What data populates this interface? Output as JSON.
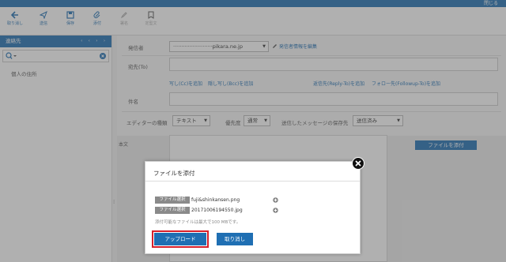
{
  "topbar": {
    "close_label": "閉じる"
  },
  "toolbar": {
    "items": [
      {
        "label": "取り消し",
        "icon": "back-arrow-icon"
      },
      {
        "label": "送信",
        "icon": "paper-plane-icon"
      },
      {
        "label": "保存",
        "icon": "floppy-disk-icon"
      },
      {
        "label": "添付",
        "icon": "paperclip-icon"
      },
      {
        "label": "署名",
        "icon": "pen-icon"
      },
      {
        "label": "定型文",
        "icon": "bookmark-icon"
      }
    ]
  },
  "sidebar": {
    "title": "連絡先",
    "nav_arrows": "‹ ‹ › ›",
    "search_placeholder": "",
    "items": [
      {
        "label": "個人の住所"
      }
    ]
  },
  "compose": {
    "from_label": "発信者",
    "from_value": "························pikara.ne.jp",
    "edit_sender_link": "発信者情報を編集",
    "to_label": "宛先(To)",
    "add_cc": "写し(Cc)を追加",
    "add_bcc": "隠し写し(Bcc)を追加",
    "add_reply_to": "返信先(Reply-To)を追加",
    "add_followup_to": "フォロー先(Followup-To)を追加",
    "subject_label": "件名",
    "editor_type_label": "エディターの種類",
    "editor_type_value": "テキスト",
    "priority_label": "優先度",
    "priority_value": "通常",
    "save_location_label": "送信したメッセージの保存先",
    "save_location_value": "送信済み",
    "body_label": "本文",
    "attach_button": "ファイルを添付"
  },
  "dialog": {
    "title": "ファイルを添付",
    "files": [
      {
        "button": "ファイル選択",
        "name": "fuji&shinkansen.png"
      },
      {
        "button": "ファイル選択",
        "name": "20171006194550.jpg"
      }
    ],
    "limit_note": "添付可能なファイルは最大で100 MBです。",
    "upload_button": "アップロード",
    "cancel_button": "取り消し"
  },
  "colors": {
    "accent": "#1f6fb3",
    "highlight": "#d7202b"
  }
}
